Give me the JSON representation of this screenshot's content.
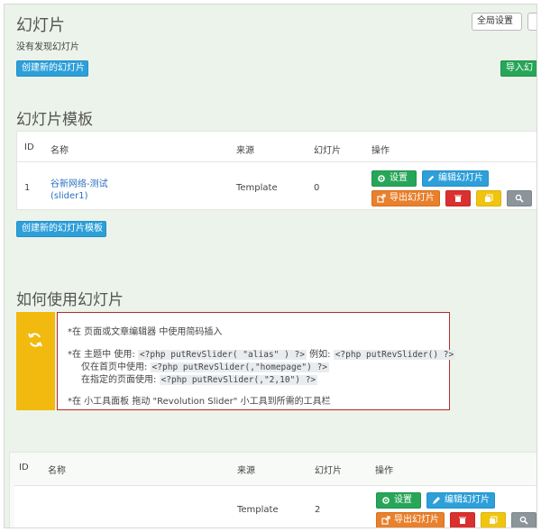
{
  "header": {
    "title": "幻灯片",
    "global_settings_label": "全局设置",
    "no_slider_text": "没有发现幻灯片",
    "create_slider_label": "创建新的幻灯片",
    "import_label": "导入幻"
  },
  "templates_section": {
    "heading": "幻灯片模板",
    "columns": [
      "ID",
      "名称",
      "来源",
      "幻灯片",
      "操作"
    ],
    "row": {
      "id": "1",
      "name": "谷新网络-测试",
      "alias": "(slider1)",
      "source": "Template",
      "slides": "0"
    },
    "create_template_label": "创建新的幻灯片模板"
  },
  "actions": {
    "settings_label": "设置",
    "edit_label": "编辑幻灯片",
    "export_label": "导出幻灯片"
  },
  "usage_section": {
    "heading": "如何使用幻灯片",
    "line1": "*在 页面或文章编辑器 中使用简码插入",
    "line2_pre": "*在 主题中 使用:",
    "line2_code1": "<?php putRevSlider( \"alias\" ) ?>",
    "line2_mid": "例如:",
    "line2_code2": "<?php putRevSlider() ?>",
    "line3_pre": "仅在首页中使用:",
    "line3_code": "<?php putRevSlider(,\"homepage\") ?>",
    "line4_pre": "在指定的页面使用:",
    "line4_code": "<?php putRevSlider(,\"2,10\") ?>",
    "line5": "*在 小工具面板 拖动 \"Revolution Slider\" 小工具到所需的工具栏"
  },
  "sliders_section": {
    "columns": [
      "ID",
      "名称",
      "来源",
      "幻灯片",
      "操作"
    ],
    "row": {
      "source": "Template",
      "slides": "2"
    }
  },
  "colors": {
    "accent_blue": "#2d9fd9",
    "green": "#27a659",
    "orange": "#e8802d",
    "red": "#d9312f",
    "yellow": "#f1c40f",
    "gray": "#8b959a",
    "usage_border": "#b52a2a"
  },
  "icons": [
    "gear-icon",
    "pencil-icon",
    "export-icon",
    "trash-icon",
    "duplicate-icon",
    "search-icon",
    "refresh-icon"
  ]
}
